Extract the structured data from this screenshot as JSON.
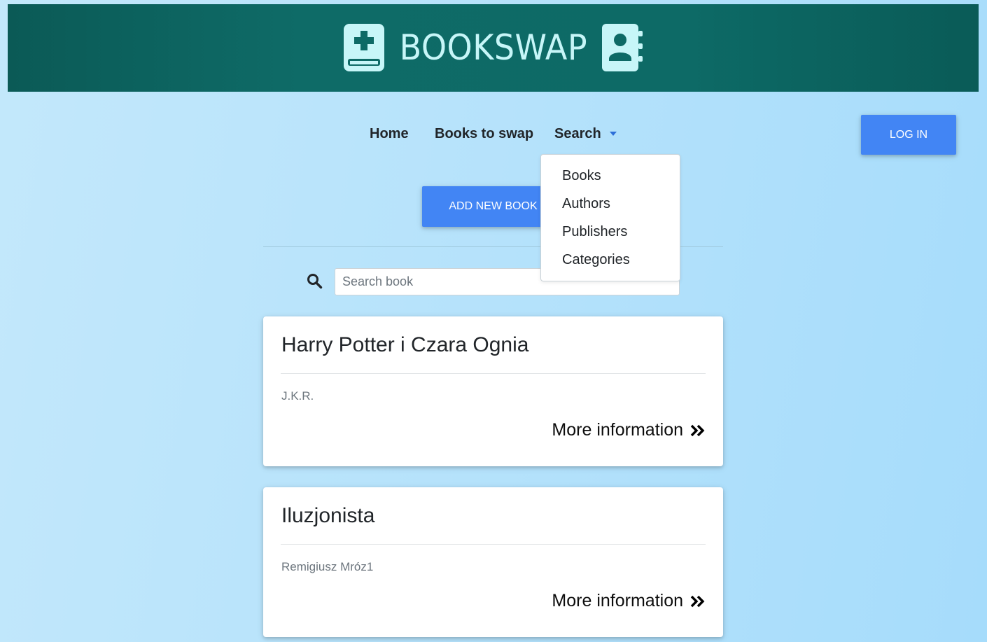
{
  "brand": {
    "name": "BOOKSWAP",
    "left_icon": "book-medical-icon",
    "right_icon": "address-book-icon"
  },
  "nav": {
    "items": [
      {
        "label": "Home"
      },
      {
        "label": "Books to swap"
      },
      {
        "label": "Search"
      }
    ],
    "login_label": "LOG IN"
  },
  "search_dropdown": {
    "items": [
      "Books",
      "Authors",
      "Publishers",
      "Categories"
    ]
  },
  "toolbar": {
    "add_book_label": "ADD NEW BOOK"
  },
  "search": {
    "placeholder": "Search book",
    "icon": "search-icon"
  },
  "books": [
    {
      "title": "Harry Potter i Czara Ognia",
      "author": "J.K.R.",
      "link_label": "More information"
    },
    {
      "title": "Iluzjonista",
      "author": "Remigiusz Mróz1",
      "link_label": "More information"
    }
  ],
  "colors": {
    "accent": "#4285f4",
    "banner": "#0d6a66",
    "brand_text": "#c7f6f8"
  }
}
